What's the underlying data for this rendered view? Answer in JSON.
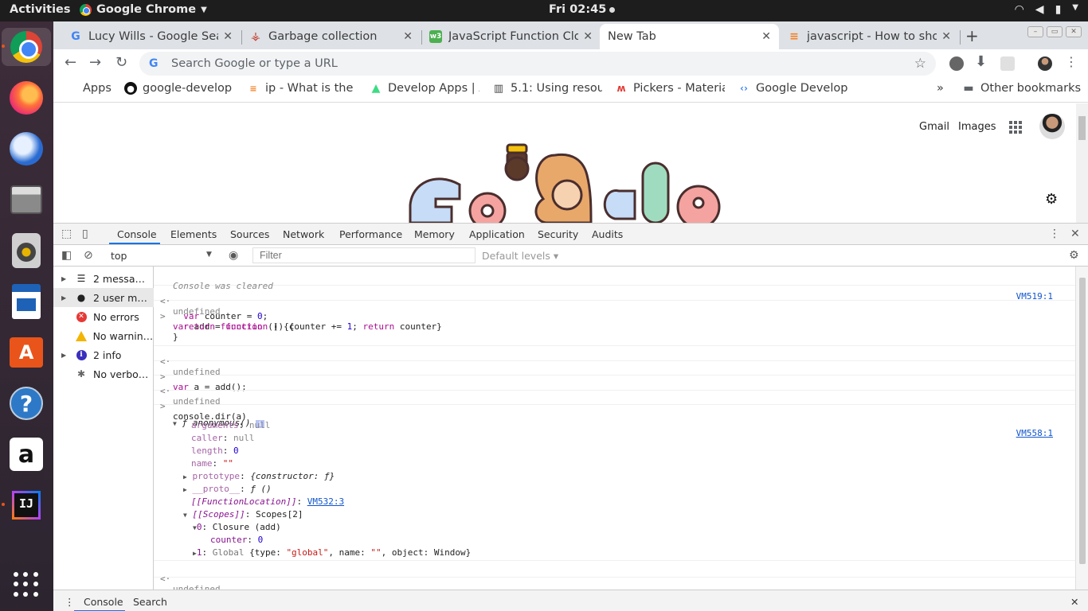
{
  "topbar": {
    "activities": "Activities",
    "app_name": "Google Chrome",
    "clock": "Fri 02:45",
    "tray_icons": [
      "wifi-icon",
      "volume-muted-icon",
      "battery-icon",
      "chevron-down-icon"
    ]
  },
  "dock": {
    "items": [
      "chrome",
      "firefox",
      "thunderbird",
      "files",
      "rhythmbox",
      "libreoffice-writer",
      "ubuntu-software",
      "help",
      "amazon",
      "intellij-idea",
      "show-applications"
    ]
  },
  "tabs": [
    {
      "title": "Lucy Wills - Google Sear",
      "favicon": "G",
      "active": false
    },
    {
      "title": "Garbage collection",
      "favicon": "gc",
      "active": false
    },
    {
      "title": "JavaScript Function Clo",
      "favicon": "w3",
      "active": false
    },
    {
      "title": "New Tab",
      "favicon": "",
      "active": true
    },
    {
      "title": "javascript - How to show",
      "favicon": "so",
      "active": false
    }
  ],
  "toolbar": {
    "omnibox_placeholder": "Search Google or type a URL"
  },
  "bookmarks": [
    {
      "label": "Apps",
      "icon": "apps-grid-icon"
    },
    {
      "label": "google-develope",
      "icon": "github-icon"
    },
    {
      "label": "ip - What is the d",
      "icon": "stackoverflow-icon"
    },
    {
      "label": "Develop Apps | A",
      "icon": "android-icon"
    },
    {
      "label": "5.1: Using resour",
      "icon": "book-icon"
    },
    {
      "label": "Pickers - Materia",
      "icon": "material-icon"
    },
    {
      "label": "Google Develop",
      "icon": "google-dev-icon"
    }
  ],
  "bookmarks_overflow": "»",
  "other_bookmarks": "Other bookmarks",
  "page": {
    "gmail": "Gmail",
    "images": "Images"
  },
  "devtools": {
    "tabs": [
      "Console",
      "Elements",
      "Sources",
      "Network",
      "Performance",
      "Memory",
      "Application",
      "Security",
      "Audits"
    ],
    "active_tab": "Console",
    "context": "top",
    "filter_placeholder": "Filter",
    "levels": "Default levels ▾",
    "sidebar": [
      {
        "label": "2 messages",
        "icon": "list-icon",
        "expandable": true
      },
      {
        "label": "2 user mes...",
        "icon": "user-icon",
        "expandable": true,
        "selected": true
      },
      {
        "label": "No errors",
        "icon": "error-icon",
        "expandable": false
      },
      {
        "label": "No warnings",
        "icon": "warning-icon",
        "expandable": false
      },
      {
        "label": "2 info",
        "icon": "info-icon",
        "expandable": true
      },
      {
        "label": "No verbose",
        "icon": "bug-icon",
        "expandable": false
      }
    ],
    "console": {
      "cleared": "Console was cleared",
      "cleared_src": "VM519:1",
      "undefined": "undefined",
      "input1_line1": "var add = function () {",
      "input1_line2": "  var counter = 0;",
      "input1_line3": "  return function () {counter += 1; return counter}",
      "input1_line4": "}",
      "input2": "var a = add();",
      "input3": "console.dir(a)",
      "dir_src": "VM558:1",
      "fn_sig": "ƒ anonymous()",
      "arguments_key": "arguments",
      "arguments_val": "null",
      "caller_key": "caller",
      "caller_val": "null",
      "length_key": "length",
      "length_val": "0",
      "name_key": "name",
      "name_val": "\"\"",
      "prototype_key": "prototype",
      "prototype_val": "{constructor: ƒ}",
      "proto_key": "__proto__",
      "proto_val": "ƒ ()",
      "fnloc_key": "[[FunctionLocation]]",
      "fnloc_val": "VM532:3",
      "scopes_key": "[[Scopes]]",
      "scopes_val": "Scopes[2]",
      "closure_key": "0",
      "closure_val": "Closure (add)",
      "counter_key": "counter",
      "counter_val": "0",
      "global_key": "1",
      "global_label": "Global",
      "global_val_a": "{type: ",
      "global_type": "\"global\"",
      "global_val_b": ", name: ",
      "global_name": "\"\"",
      "global_val_c": ", object: Window}"
    },
    "drawer_tabs": [
      "Console",
      "Search"
    ]
  }
}
